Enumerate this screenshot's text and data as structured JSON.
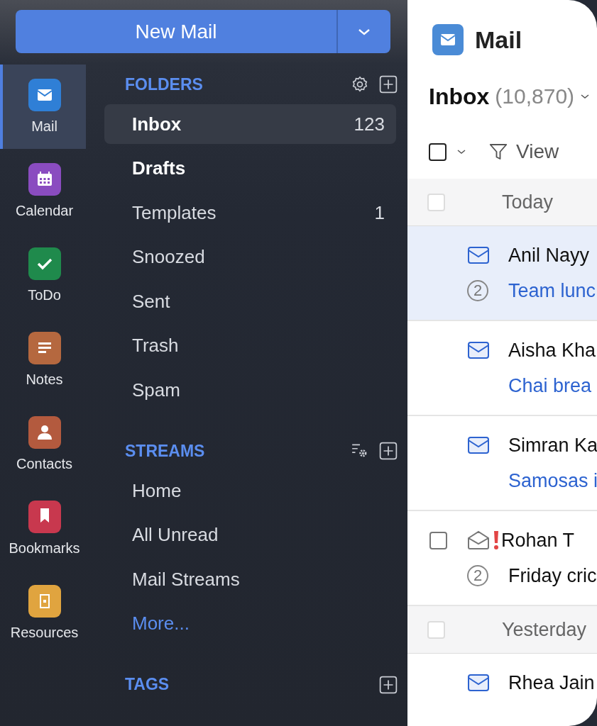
{
  "new_mail_button": {
    "label": "New Mail"
  },
  "apps": [
    {
      "label": "Mail",
      "selected": true,
      "color": "#2f7fd6"
    },
    {
      "label": "Calendar",
      "selected": false,
      "color": "#8a4cc0"
    },
    {
      "label": "ToDo",
      "selected": false,
      "color": "#1f8a4c"
    },
    {
      "label": "Notes",
      "selected": false,
      "color": "#b5683f"
    },
    {
      "label": "Contacts",
      "selected": false,
      "color": "#b35a3e"
    },
    {
      "label": "Bookmarks",
      "selected": false,
      "color": "#c8384e"
    },
    {
      "label": "Resources",
      "selected": false,
      "color": "#e0a43f"
    }
  ],
  "sections": [
    {
      "title": "FOLDERS",
      "items": [
        {
          "label": "Inbox",
          "selected": true,
          "unread": true,
          "count": "123"
        },
        {
          "label": "Drafts",
          "selected": false,
          "unread": true
        },
        {
          "label": "Templates",
          "selected": false,
          "unread": false,
          "count": "1"
        },
        {
          "label": "Snoozed",
          "selected": false,
          "unread": false
        },
        {
          "label": "Sent",
          "selected": false,
          "unread": false
        },
        {
          "label": "Trash",
          "selected": false,
          "unread": false
        },
        {
          "label": "Spam",
          "selected": false,
          "unread": false
        }
      ]
    },
    {
      "title": "STREAMS",
      "items": [
        {
          "label": "Home",
          "selected": false,
          "unread": false
        },
        {
          "label": "All Unread",
          "selected": false,
          "unread": false
        },
        {
          "label": "Mail Streams",
          "selected": false,
          "unread": false
        },
        {
          "label": "More...",
          "selected": false,
          "unread": false,
          "kind": "link"
        }
      ]
    },
    {
      "title": "TAGS"
    }
  ],
  "mail": {
    "title": "Mail",
    "folder": "Inbox",
    "total": "(10,870)",
    "view_label": "View",
    "select_all": {
      "checked": false
    },
    "list": [
      {
        "kind": "group",
        "label": "Today",
        "checked": false
      },
      {
        "kind": "message",
        "sender": "Anil Nayy",
        "subject": "Team lunc",
        "unread": true,
        "selected": true,
        "flagged": false,
        "thread_count": "2"
      },
      {
        "kind": "message",
        "sender": "Aisha Kha",
        "subject": "Chai brea",
        "unread": true,
        "selected": false,
        "flagged": false
      },
      {
        "kind": "message",
        "sender": "Simran Ka",
        "subject": "Samosas i",
        "unread": true,
        "selected": false,
        "flagged": false
      },
      {
        "kind": "message",
        "sender": "Rohan T",
        "subject": "Friday cric",
        "unread": false,
        "selected": false,
        "flagged": true,
        "checkbox": {
          "checked": false
        },
        "thread_count": "2"
      },
      {
        "kind": "group",
        "label": "Yesterday",
        "checked": false
      },
      {
        "kind": "message",
        "sender": "Rhea Jain",
        "unread": true,
        "selected": false,
        "flagged": false
      }
    ]
  }
}
